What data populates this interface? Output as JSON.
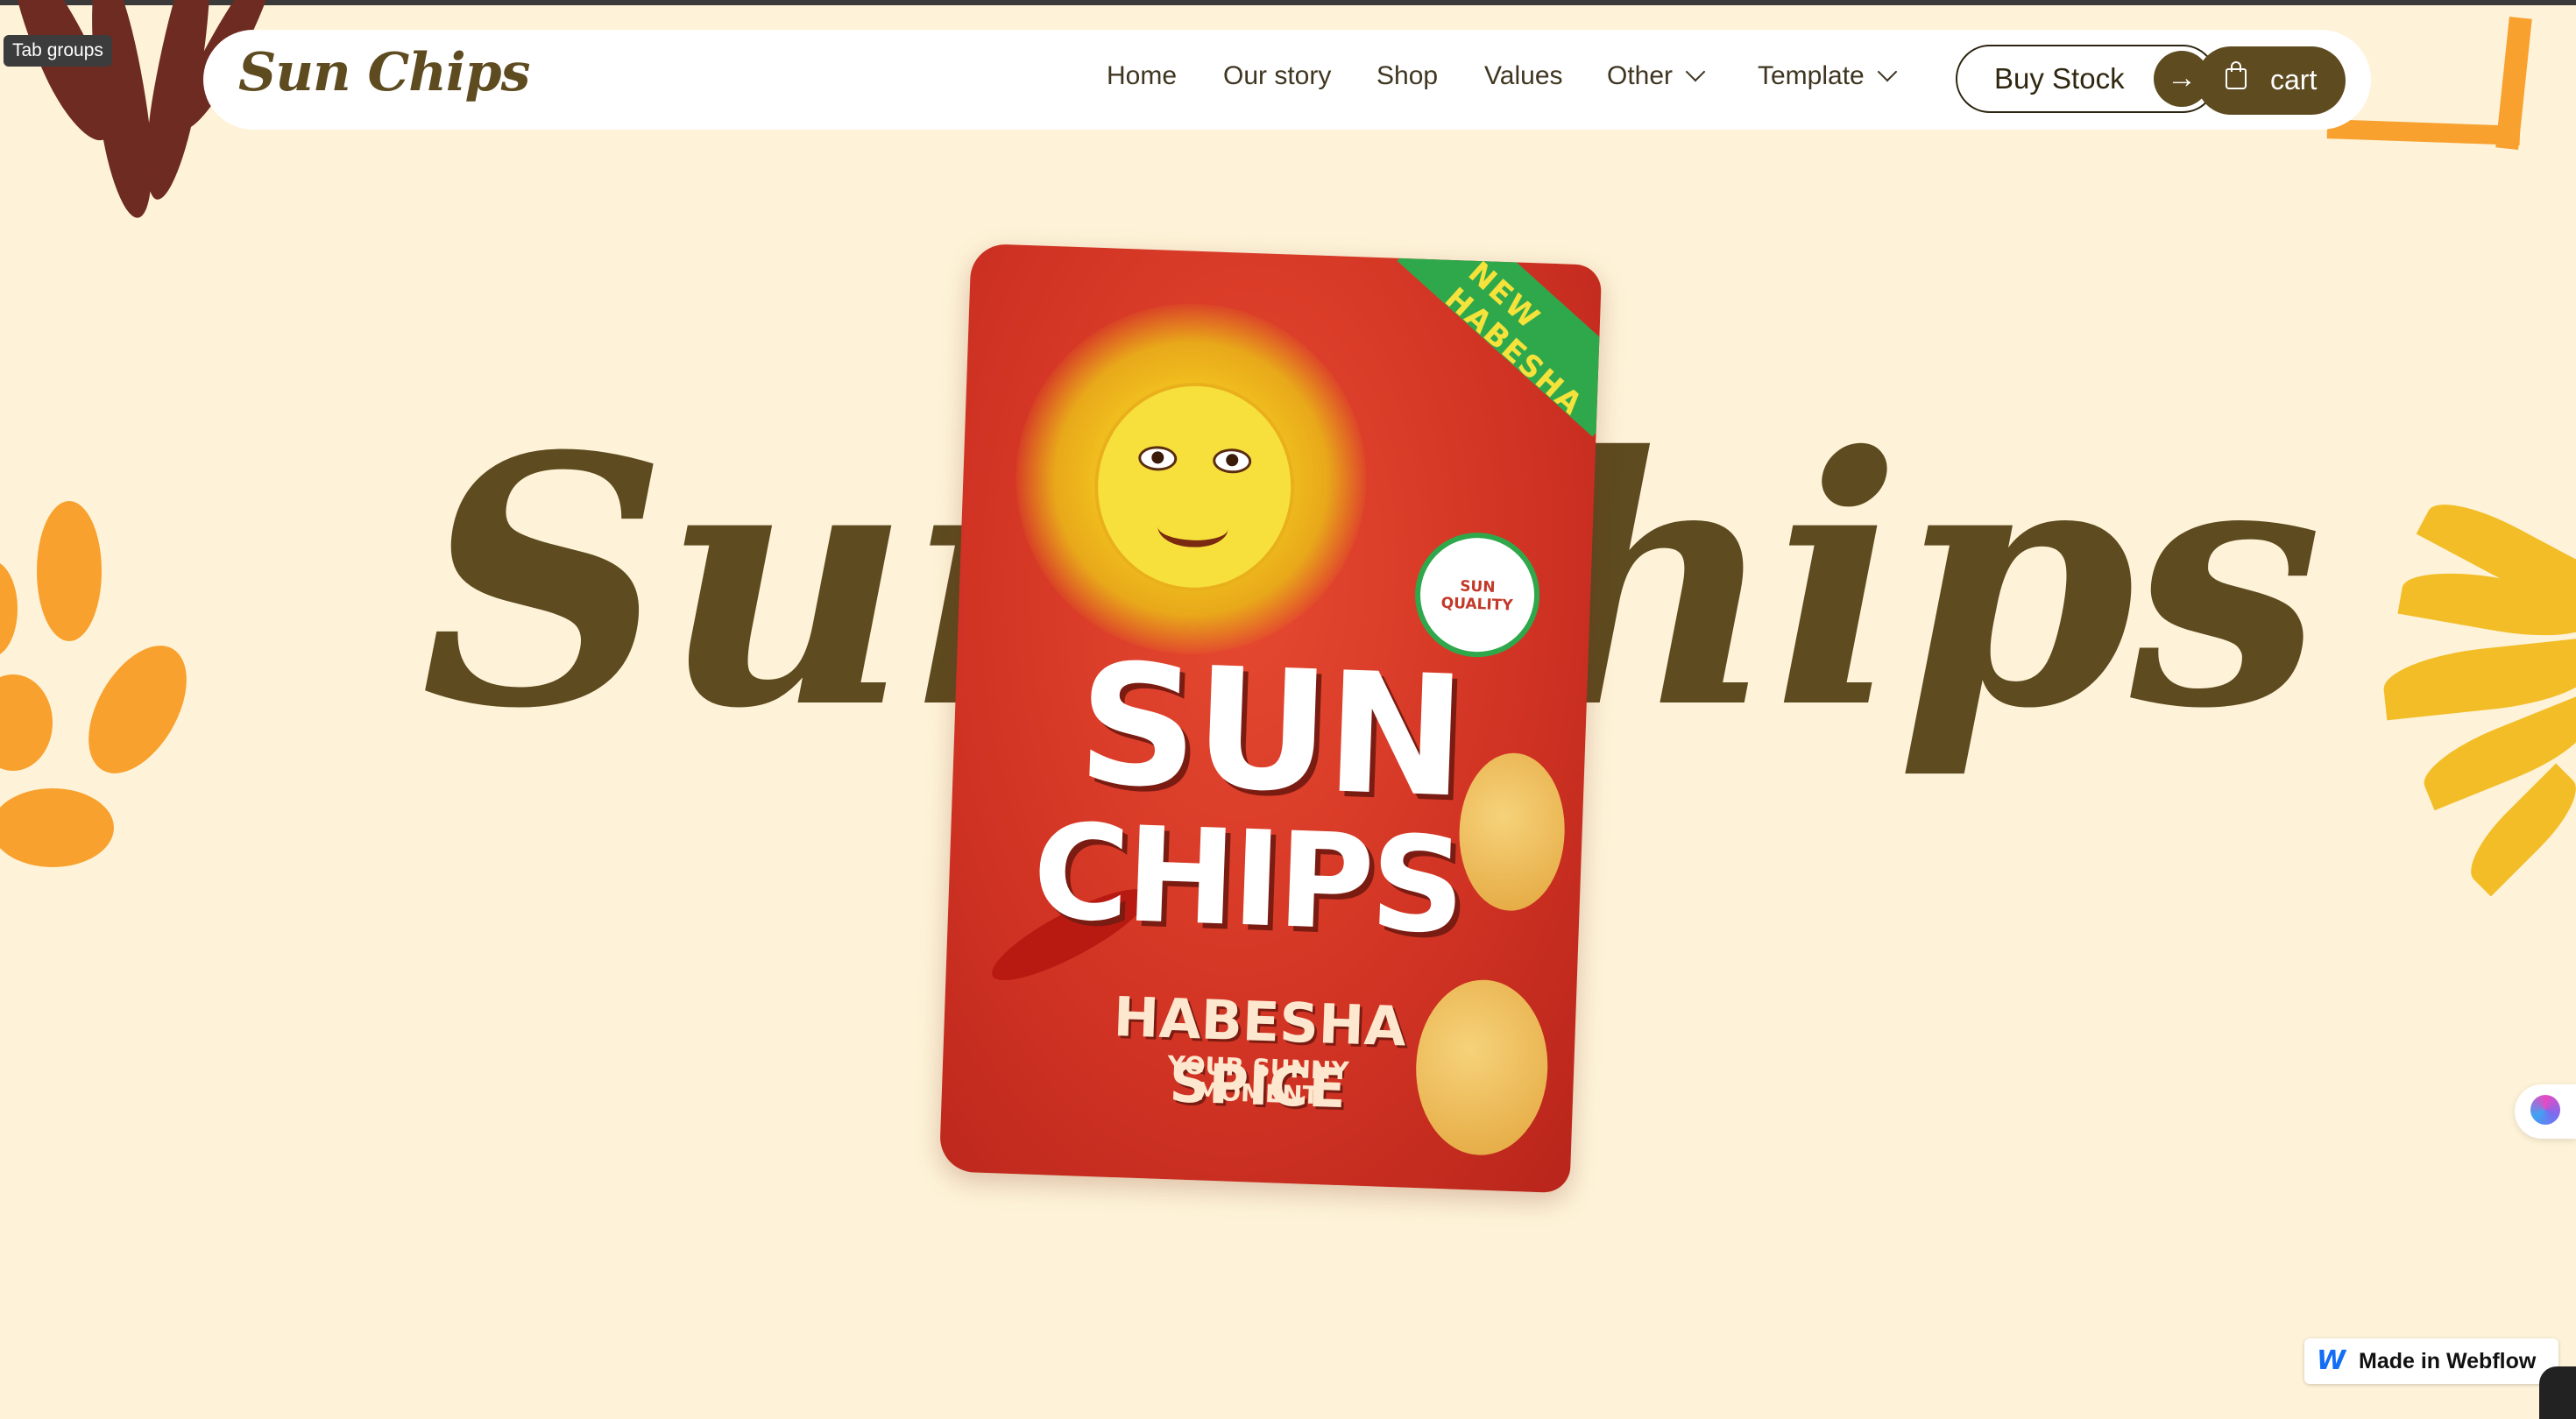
{
  "browser": {
    "tab_groups_label": "Tab groups"
  },
  "navbar": {
    "logo": "Sun Chips",
    "links": [
      {
        "label": "Home"
      },
      {
        "label": "Our story"
      },
      {
        "label": "Shop"
      },
      {
        "label": "Values"
      },
      {
        "label": "Other",
        "has_dropdown": true
      },
      {
        "label": "Template",
        "has_dropdown": true
      }
    ],
    "buy_stock_label": "Buy Stock",
    "buy_stock_icon": "arrow-right-icon",
    "cart_label": "cart",
    "cart_icon": "shopping-bag-icon"
  },
  "hero": {
    "title": "Sun Chips",
    "product": {
      "brand_line1": "SUN",
      "brand_line2": "CHIPS",
      "flavor": "HABESHA SPICE",
      "tagline_line1": "YOUR SUNNY",
      "tagline_line2": "MOMENT",
      "badge": "SUN QUALITY",
      "corner_tag": "NEW HABESHA"
    }
  },
  "footer": {
    "webflow_badge": "Made in Webflow"
  },
  "colors": {
    "background": "#fef3d8",
    "brand_brown": "#5e4b20",
    "leaf_brown": "#6e2b22",
    "leaf_orange": "#f8a12f",
    "leaf_yellow": "#f3bd28",
    "bag_red": "#d23424"
  }
}
